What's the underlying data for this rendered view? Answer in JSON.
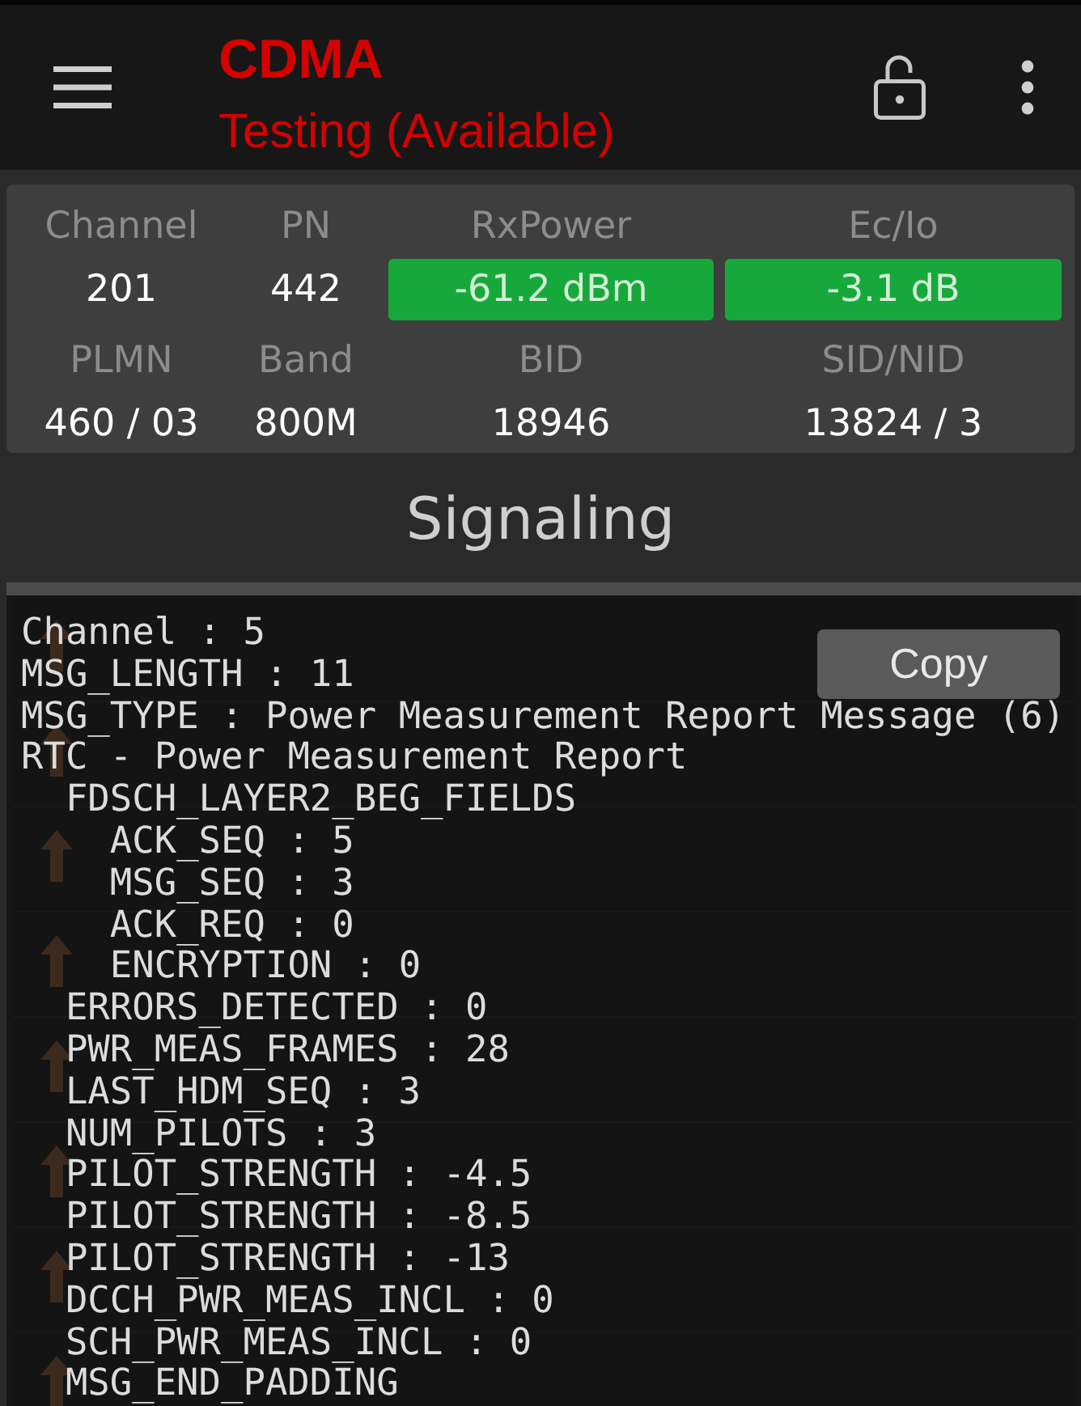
{
  "app_bar": {
    "title": "CDMA",
    "subtitle": "Testing (Available)"
  },
  "stats": [
    {
      "label": "Channel",
      "value": "201",
      "kind": "plain"
    },
    {
      "label": "PN",
      "value": "442",
      "kind": "plain"
    },
    {
      "label": "RxPower",
      "value": "-61.2 dBm",
      "kind": "badge"
    },
    {
      "label": "Ec/Io",
      "value": "-3.1 dB",
      "kind": "badge"
    },
    {
      "label": "PLMN",
      "value": "460 / 03",
      "kind": "plain"
    },
    {
      "label": "Band",
      "value": "800M",
      "kind": "plain"
    },
    {
      "label": "BID",
      "value": "18946",
      "kind": "plain"
    },
    {
      "label": "SID/NID",
      "value": "13824 / 3",
      "kind": "plain"
    }
  ],
  "section_title": "Signaling",
  "detail_popup": {
    "copy_button": "Copy",
    "lines": [
      {
        "text": "Channel : 5"
      },
      {
        "text": "MSG_LENGTH : 11"
      },
      {
        "text": "MSG_TYPE : Power Measurement Report Message (6)"
      },
      {
        "text": "RTC - Power Measurement Report",
        "children": [
          {
            "text": "FDSCH_LAYER2_BEG_FIELDS",
            "children": [
              {
                "text": "ACK_SEQ : 5"
              },
              {
                "text": "MSG_SEQ : 3"
              },
              {
                "text": "ACK_REQ : 0"
              },
              {
                "text": "ENCRYPTION : 0"
              }
            ]
          },
          {
            "text": "ERRORS_DETECTED : 0"
          },
          {
            "text": "PWR_MEAS_FRAMES : 28"
          },
          {
            "text": "LAST_HDM_SEQ : 3"
          },
          {
            "text": "NUM_PILOTS : 3"
          },
          {
            "text": "PILOT_STRENGTH : -4.5"
          },
          {
            "text": "PILOT_STRENGTH : -8.5"
          },
          {
            "text": "PILOT_STRENGTH : -13"
          },
          {
            "text": "DCCH_PWR_MEAS_INCL : 0"
          },
          {
            "text": "SCH_PWR_MEAS_INCL : 0"
          },
          {
            "text": "MSG_END_PADDING"
          }
        ]
      }
    ]
  }
}
